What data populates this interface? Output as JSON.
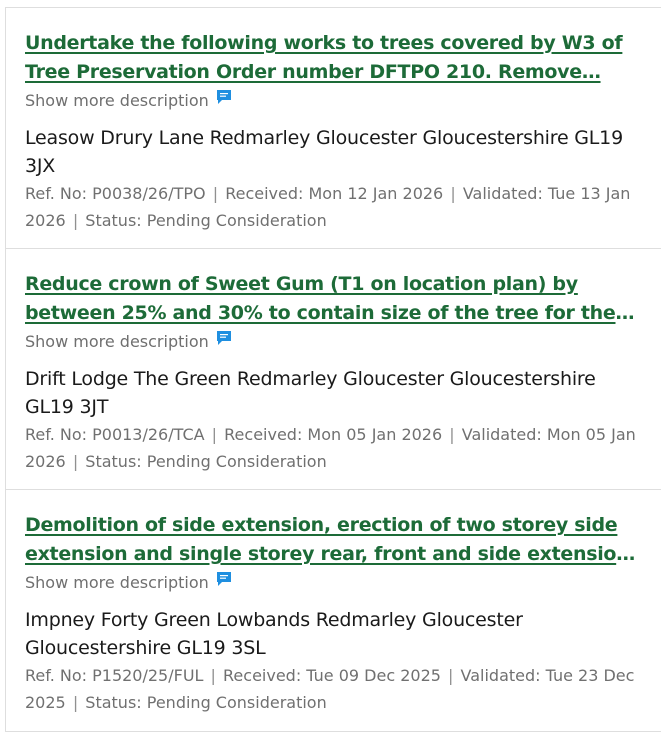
{
  "results": [
    {
      "title": "Undertake the following works to trees covered by W3 of Tree Preservation Order number DFTPO 210. Remove…",
      "show_more": "Show more description",
      "address": "Leasow Drury Lane Redmarley Gloucester Gloucestershire GL19 3JX",
      "ref": "Ref. No: P0038/26/TPO",
      "received": "Received: Mon 12 Jan 2026",
      "validated": "Validated: Tue 13 Jan 2026",
      "status": "Status: Pending Consideration"
    },
    {
      "title": "Reduce crown of Sweet Gum (T1 on location plan) by between 25% and 30% to contain size of the tree for the area it is…",
      "show_more": "Show more description",
      "address": "Drift Lodge The Green Redmarley Gloucester Gloucestershire GL19 3JT",
      "ref": "Ref. No: P0013/26/TCA",
      "received": "Received: Mon 05 Jan 2026",
      "validated": "Validated: Mon 05 Jan 2026",
      "status": "Status: Pending Consideration"
    },
    {
      "title": "Demolition of side extension, erection of two storey side extension and single storey rear, front and side extensions wit…",
      "show_more": "Show more description",
      "address": "Impney Forty Green Lowbands Redmarley Gloucester Gloucestershire GL19 3SL",
      "ref": "Ref. No: P1520/25/FUL",
      "received": "Received: Tue 09 Dec 2025",
      "validated": "Validated: Tue 23 Dec 2025",
      "status": "Status: Pending Consideration"
    }
  ],
  "separator": "|",
  "colors": {
    "link": "#1d6b38",
    "icon": "#1f8fe0",
    "meta": "#707070"
  },
  "icons": {
    "show_more": "comment-icon"
  }
}
